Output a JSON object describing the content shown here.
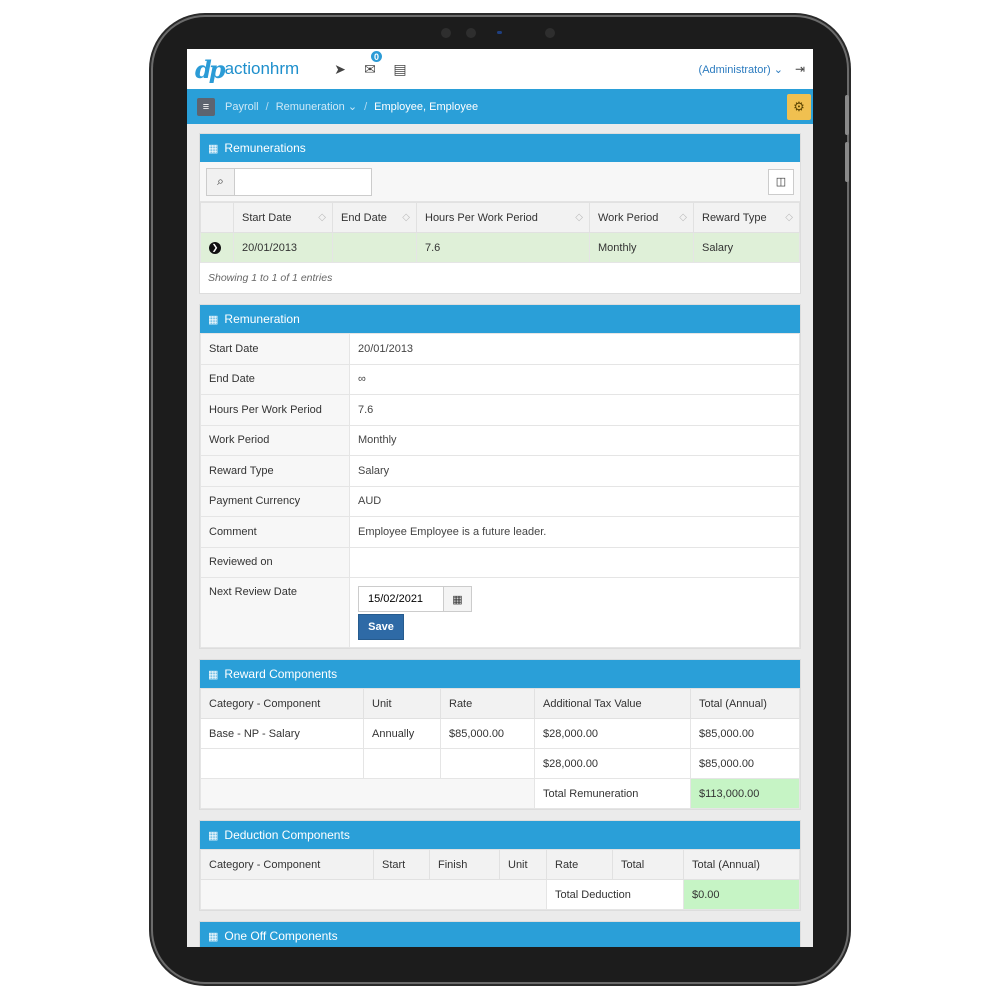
{
  "app": {
    "logo_text": "actionhrm",
    "logo_mark": "dp",
    "admin_label": "(Administrator) ⌄",
    "notification_count": "0"
  },
  "breadcrumb": {
    "items": [
      "Payroll",
      "Remuneration ⌄"
    ],
    "current": "Employee, Employee"
  },
  "remunerations": {
    "title": "Remunerations",
    "search_placeholder": "",
    "columns": [
      "Start Date",
      "End Date",
      "Hours Per Work Period",
      "Work Period",
      "Reward Type"
    ],
    "rows": [
      [
        "20/01/2013",
        "",
        "7.6",
        "Monthly",
        "Salary"
      ]
    ],
    "footer": "Showing 1 to 1 of 1 entries"
  },
  "remuneration": {
    "title": "Remuneration",
    "fields": [
      {
        "label": "Start Date",
        "value": "20/01/2013"
      },
      {
        "label": "End Date",
        "value": "∞"
      },
      {
        "label": "Hours Per Work Period",
        "value": "7.6"
      },
      {
        "label": "Work Period",
        "value": "Monthly"
      },
      {
        "label": "Reward Type",
        "value": "Salary"
      },
      {
        "label": "Payment Currency",
        "value": "AUD"
      },
      {
        "label": "Comment",
        "value": "Employee Employee is a future leader."
      },
      {
        "label": "Reviewed on",
        "value": ""
      }
    ],
    "next_review_label": "Next Review Date",
    "next_review_value": "15/02/2021",
    "save_label": "Save"
  },
  "reward": {
    "title": "Reward Components",
    "columns": [
      "Category - Component",
      "Unit",
      "Rate",
      "Additional Tax Value",
      "Total (Annual)"
    ],
    "rows": [
      [
        "Base - NP - Salary",
        "Annually",
        "$85,000.00",
        "$28,000.00",
        "$85,000.00"
      ],
      [
        "",
        "",
        "",
        "$28,000.00",
        "$85,000.00"
      ]
    ],
    "total_label": "Total Remuneration",
    "total_value": "$113,000.00"
  },
  "deduction": {
    "title": "Deduction Components",
    "columns": [
      "Category - Component",
      "Start",
      "Finish",
      "Unit",
      "Rate",
      "Total",
      "Total (Annual)"
    ],
    "total_label": "Total Deduction",
    "total_value": "$0.00"
  },
  "oneoff": {
    "title": "One Off Components"
  },
  "colors": {
    "accent": "#2a9fd8",
    "positive": "#c6f4c5",
    "selected_row": "#dff0d8",
    "save": "#2e6aa6"
  }
}
